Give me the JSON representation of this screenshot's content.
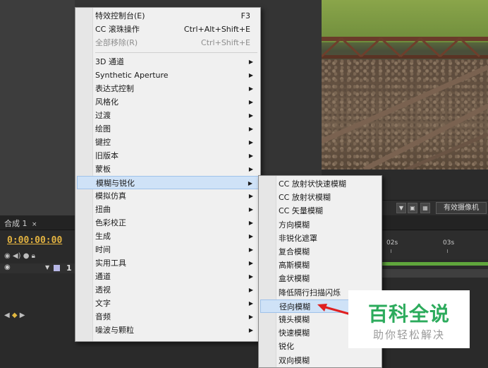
{
  "context_menu": {
    "items": [
      {
        "label": "特效控制台(E)",
        "shortcut": "F3"
      },
      {
        "label": "CC 滚珠操作",
        "shortcut": "Ctrl+Alt+Shift+E"
      },
      {
        "label": "全部移除(R)",
        "shortcut": "Ctrl+Shift+E"
      },
      {
        "label": "3D 通道"
      },
      {
        "label": "Synthetic Aperture"
      },
      {
        "label": "表达式控制"
      },
      {
        "label": "风格化"
      },
      {
        "label": "过渡"
      },
      {
        "label": "绘图"
      },
      {
        "label": "键控"
      },
      {
        "label": "旧版本"
      },
      {
        "label": "蒙板"
      },
      {
        "label": "模糊与锐化"
      },
      {
        "label": "模拟仿真"
      },
      {
        "label": "扭曲"
      },
      {
        "label": "色彩校正"
      },
      {
        "label": "生成"
      },
      {
        "label": "时间"
      },
      {
        "label": "实用工具"
      },
      {
        "label": "通道"
      },
      {
        "label": "透视"
      },
      {
        "label": "文字"
      },
      {
        "label": "音频"
      },
      {
        "label": "噪波与颗粒"
      }
    ],
    "highlighted": "模糊与锐化"
  },
  "submenu": {
    "items": [
      {
        "label": "CC 放射状快速模糊"
      },
      {
        "label": "CC 放射状模糊"
      },
      {
        "label": "CC 矢量模糊"
      },
      {
        "label": "方向模糊"
      },
      {
        "label": "非锐化遮罩"
      },
      {
        "label": "复合模糊"
      },
      {
        "label": "高斯模糊"
      },
      {
        "label": "盒状模糊"
      },
      {
        "label": "降低隔行扫描闪烁"
      },
      {
        "label": "径向模糊"
      },
      {
        "label": "镜头模糊"
      },
      {
        "label": "快速模糊"
      },
      {
        "label": "锐化"
      },
      {
        "label": "双向模糊"
      }
    ],
    "highlighted": "径向模糊"
  },
  "viewer_bar": {
    "camera_label": "有效摄像机"
  },
  "timeline": {
    "tab_label": "合成 1",
    "tab_close": "×",
    "timecode": "0:00:00:00",
    "ruler_labels": [
      "02s",
      "03s"
    ],
    "layer_number": "1"
  },
  "watermark": {
    "title": "百科全说",
    "subtitle": "助你轻松解决"
  },
  "colors": {
    "menu_bg": "#f0f0f0",
    "highlight": "#cfe2f7",
    "watermark_green": "#2cab5c",
    "arrow_red": "#e02020",
    "timecode": "#e3b341"
  }
}
